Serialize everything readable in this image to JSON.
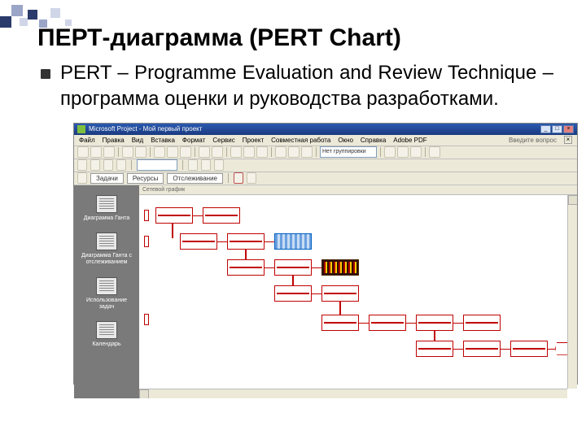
{
  "heading": "ПЕРТ-диаграмма (PERT Chart)",
  "bullet": "PERT – Programme Evaluation and Review Technique – программа оценки и руководства разработками.",
  "app": {
    "title": "Microsoft Project - Мой первый проект",
    "help_hint": "Введите вопрос",
    "menu": [
      "Файл",
      "Правка",
      "Вид",
      "Вставка",
      "Формат",
      "Сервис",
      "Проект",
      "Совместная работа",
      "Окно",
      "Справка",
      "Adobe PDF"
    ],
    "toolbar_dropdown": "Нет группировки",
    "tabs": [
      "Задачи",
      "Ресурсы",
      "Отслеживание"
    ],
    "canvas_label": "Сетевой график"
  },
  "sidebar": [
    {
      "label": "Диаграмма Ганта"
    },
    {
      "label": "Диаграмма Ганта с отслеживанием"
    },
    {
      "label": "Использование задач"
    },
    {
      "label": "Календарь"
    }
  ],
  "chart_data": {
    "type": "pert-network",
    "note": "PERT network diagram with task nodes and dependency connectors; specific task labels not legible at source resolution",
    "nodes": [
      {
        "id": "n1",
        "row": 0,
        "col": 0
      },
      {
        "id": "n2",
        "row": 0,
        "col": 1
      },
      {
        "id": "n3",
        "row": 1,
        "col": 1
      },
      {
        "id": "n4",
        "row": 1,
        "col": 2
      },
      {
        "id": "n5",
        "row": 1,
        "col": 3,
        "style": "selected"
      },
      {
        "id": "n6",
        "row": 2,
        "col": 2
      },
      {
        "id": "n7",
        "row": 2,
        "col": 3
      },
      {
        "id": "n8",
        "row": 2,
        "col": 4,
        "style": "highlight"
      },
      {
        "id": "n9",
        "row": 3,
        "col": 3
      },
      {
        "id": "n10",
        "row": 3,
        "col": 4
      },
      {
        "id": "n11",
        "row": 4,
        "col": 4
      },
      {
        "id": "n12",
        "row": 4,
        "col": 5
      },
      {
        "id": "n13",
        "row": 4,
        "col": 6
      },
      {
        "id": "n14",
        "row": 4,
        "col": 7
      },
      {
        "id": "n15",
        "row": 5,
        "col": 6
      },
      {
        "id": "n16",
        "row": 5,
        "col": 7
      },
      {
        "id": "n17",
        "row": 5,
        "col": 8
      },
      {
        "id": "n18",
        "row": 5,
        "col": 9,
        "style": "hex"
      }
    ],
    "edges": [
      [
        "n1",
        "n2"
      ],
      [
        "n1",
        "n3"
      ],
      [
        "n3",
        "n4"
      ],
      [
        "n4",
        "n5"
      ],
      [
        "n4",
        "n6"
      ],
      [
        "n6",
        "n7"
      ],
      [
        "n7",
        "n8"
      ],
      [
        "n7",
        "n9"
      ],
      [
        "n9",
        "n10"
      ],
      [
        "n10",
        "n11"
      ],
      [
        "n11",
        "n12"
      ],
      [
        "n12",
        "n13"
      ],
      [
        "n13",
        "n14"
      ],
      [
        "n13",
        "n15"
      ],
      [
        "n15",
        "n16"
      ],
      [
        "n16",
        "n17"
      ],
      [
        "n17",
        "n18"
      ]
    ]
  }
}
